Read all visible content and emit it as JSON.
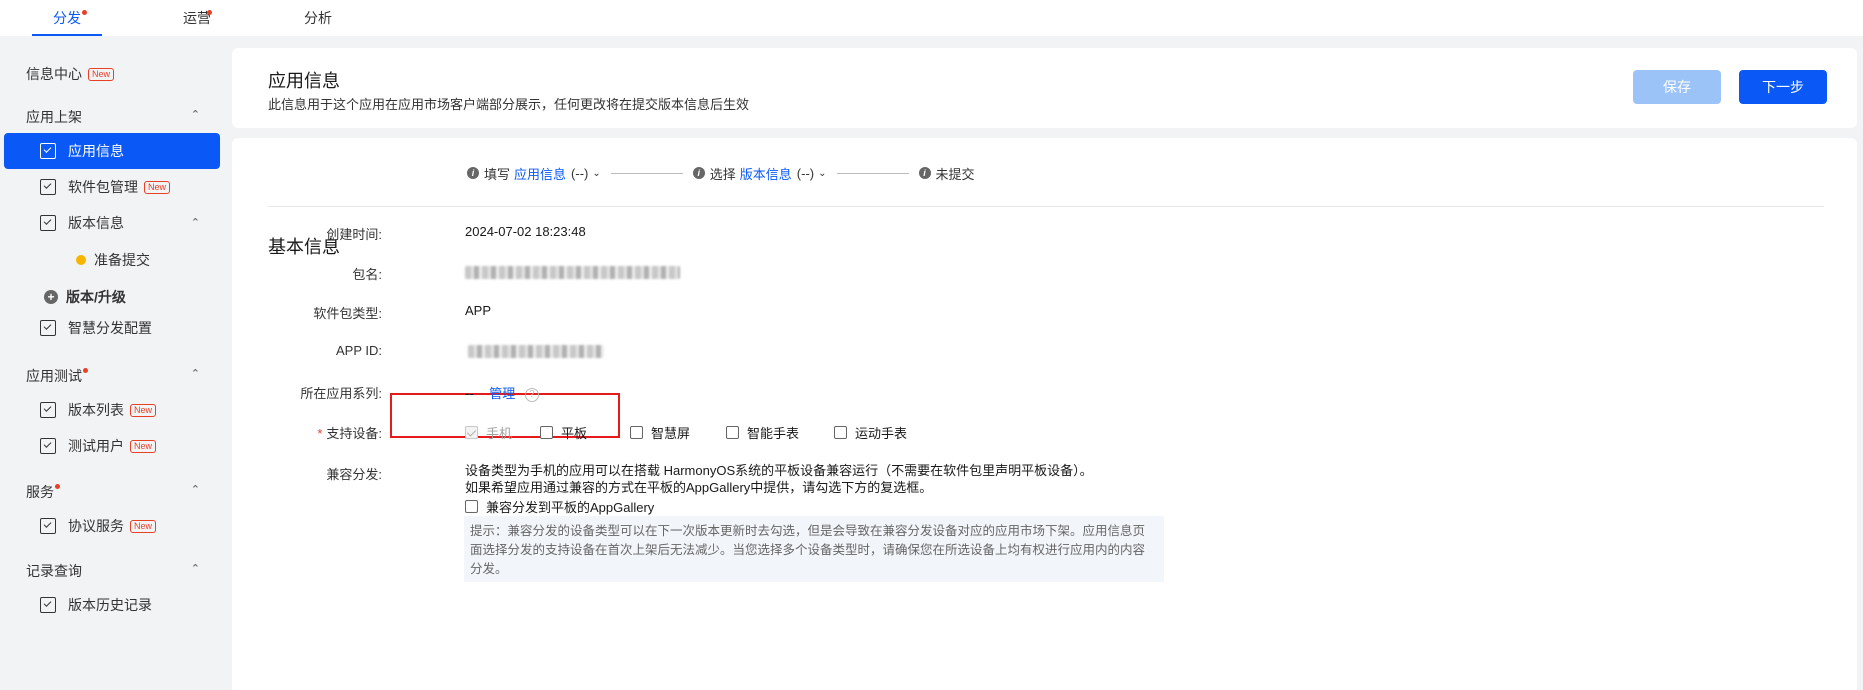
{
  "top_tabs": [
    {
      "label": "分发",
      "active": true,
      "dot": true
    },
    {
      "label": "运营",
      "active": false,
      "dot": true
    },
    {
      "label": "分析",
      "active": false,
      "dot": false
    }
  ],
  "sidebar": {
    "info_center": {
      "label": "信息中心",
      "badge": "New"
    },
    "group_listing": {
      "label": "应用上架"
    },
    "items_listing": [
      {
        "label": "应用信息",
        "active": true
      },
      {
        "label": "软件包管理",
        "badge": "New"
      },
      {
        "label": "版本信息"
      }
    ],
    "version_sub": {
      "label": "准备提交"
    },
    "version_upgrade": {
      "label": "版本/升级"
    },
    "smart_dist": {
      "label": "智慧分发配置"
    },
    "group_testing": {
      "label": "应用测试"
    },
    "items_testing": [
      {
        "label": "版本列表",
        "badge": "New"
      },
      {
        "label": "测试用户",
        "badge": "New"
      }
    ],
    "group_service": {
      "label": "服务"
    },
    "items_service": [
      {
        "label": "协议服务",
        "badge": "New"
      }
    ],
    "group_records": {
      "label": "记录查询"
    },
    "items_records": [
      {
        "label": "版本历史记录"
      }
    ]
  },
  "header": {
    "title": "应用信息",
    "subtitle": "此信息用于这个应用在应用市场客户端部分展示，任何更改将在提交版本信息后生效",
    "save_label": "保存",
    "next_label": "下一步"
  },
  "steps": {
    "step1_prefix": "填写",
    "step1_link": "应用信息",
    "step1_value": "(--)",
    "step2_prefix": "选择",
    "step2_link": "版本信息",
    "step2_value": "(--)",
    "step3_label": "未提交"
  },
  "basic_info": {
    "section_title": "基本信息",
    "created_label": "创建时间:",
    "created_value": "2024-07-02 18:23:48",
    "package_label": "包名:",
    "package_type_label": "软件包类型:",
    "package_type_value": "APP",
    "app_id_label": "APP ID:",
    "series_label": "所在应用系列:",
    "series_value": "--",
    "series_manage": "管理",
    "devices_label": "支持设备:",
    "devices": [
      {
        "label": "手机",
        "checked": true,
        "disabled": true
      },
      {
        "label": "平板",
        "checked": false
      },
      {
        "label": "智慧屏",
        "checked": false
      },
      {
        "label": "智能手表",
        "checked": false
      },
      {
        "label": "运动手表",
        "checked": false
      }
    ],
    "compat_label": "兼容分发:",
    "compat_line1": "设备类型为手机的应用可以在搭载 HarmonyOS系统的平板设备兼容运行（不需要在软件包里声明平板设备）。",
    "compat_line2": "如果希望应用通过兼容的方式在平板的AppGallery中提供，请勾选下方的复选框。",
    "compat_checkbox": "兼容分发到平板的AppGallery",
    "tip_line1": "提示：兼容分发的设备类型可以在下一次版本更新时去勾选，但是会导致在兼容分发设备对应的应用市场下架。应用信息页",
    "tip_line2": "面选择分发的支持设备在首次上架后无法减少。当您选择多个设备类型时，请确保您在所选设备上均有权进行应用内的内容",
    "tip_line3": "分发。"
  },
  "colors": {
    "primary": "#0a59f7",
    "primary_disabled": "#9cc3f8",
    "alert": "#e84026",
    "highlight": "#e51b1b"
  }
}
